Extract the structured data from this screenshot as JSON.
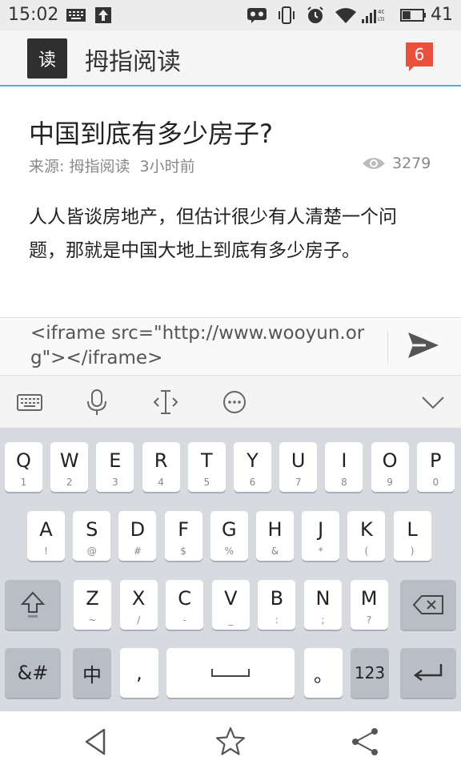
{
  "status_bar": {
    "time": "15:02",
    "network": "4G LTE",
    "battery": "41",
    "icons": [
      "keyboard-icon",
      "upload-icon",
      "voicemail-icon",
      "vibrate-icon",
      "alarm-icon",
      "wifi-icon",
      "signal-icon",
      "battery-icon"
    ]
  },
  "app": {
    "logo_char": "读",
    "title": "拇指阅读",
    "notification_count": "6",
    "accent_color": "#5fa8d3",
    "badge_color": "#e9513e"
  },
  "article": {
    "title": "中国到底有多少房子?",
    "meta": "来源: 拇指阅读  3小时前",
    "views": "3279",
    "body": "人人皆谈房地产，但估计很少有人清楚一个问题，那就是中国大地上到底有多少房子。"
  },
  "comment_input": {
    "value": "<iframe src=\"http://www.wooyun.org\"></iframe>"
  },
  "keyboard_toolbar": [
    "keyboard-icon",
    "microphone-icon",
    "text-cursor-icon",
    "more-icon",
    "chevron-down-icon"
  ],
  "keyboard": {
    "row1": [
      {
        "main": "Q",
        "sub": "1"
      },
      {
        "main": "W",
        "sub": "2"
      },
      {
        "main": "E",
        "sub": "3"
      },
      {
        "main": "R",
        "sub": "4"
      },
      {
        "main": "T",
        "sub": "5"
      },
      {
        "main": "Y",
        "sub": "6"
      },
      {
        "main": "U",
        "sub": "7"
      },
      {
        "main": "I",
        "sub": "8"
      },
      {
        "main": "O",
        "sub": "9"
      },
      {
        "main": "P",
        "sub": "0"
      }
    ],
    "row2": [
      {
        "main": "A",
        "sub": "!"
      },
      {
        "main": "S",
        "sub": "@"
      },
      {
        "main": "D",
        "sub": "#"
      },
      {
        "main": "F",
        "sub": "$"
      },
      {
        "main": "G",
        "sub": "%"
      },
      {
        "main": "H",
        "sub": "&"
      },
      {
        "main": "J",
        "sub": "*"
      },
      {
        "main": "K",
        "sub": "("
      },
      {
        "main": "L",
        "sub": ")"
      }
    ],
    "row3": [
      {
        "main": "Z",
        "sub": "~"
      },
      {
        "main": "X",
        "sub": "/"
      },
      {
        "main": "C",
        "sub": "-"
      },
      {
        "main": "V",
        "sub": "_"
      },
      {
        "main": "B",
        "sub": ":"
      },
      {
        "main": "N",
        "sub": ";"
      },
      {
        "main": "M",
        "sub": "?"
      }
    ],
    "symbols_key": "&#",
    "chinese_key": "中",
    "comma_key": ",",
    "period_key": "。",
    "numbers_key": "123"
  },
  "nav": [
    "back-icon",
    "favorite-star-icon",
    "share-icon"
  ]
}
